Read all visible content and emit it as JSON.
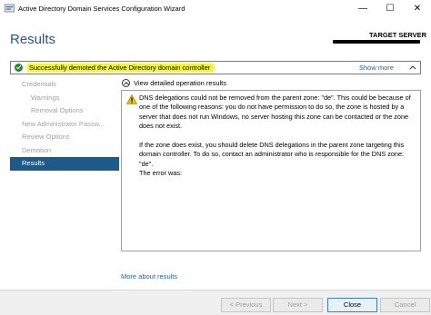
{
  "window": {
    "title": "Active Directory Domain Services Configuration Wizard",
    "min_glyph": "—",
    "max_glyph": "☐",
    "close_glyph": "✕"
  },
  "header": {
    "page_title": "Results",
    "target_label": "TARGET SERVER"
  },
  "status": {
    "message": "Successfully demoted the Active Directory domain controller",
    "show_more": "Show more",
    "highlight_color": "#f3f52e",
    "success_color": "#1e8c2f"
  },
  "nav": {
    "items": [
      {
        "label": "Credentials",
        "sub": false,
        "active": false
      },
      {
        "label": "Warnings",
        "sub": true,
        "active": false
      },
      {
        "label": "Removal Options",
        "sub": true,
        "active": false
      },
      {
        "label": "New Administrator Passw...",
        "sub": false,
        "active": false
      },
      {
        "label": "Review Options",
        "sub": false,
        "active": false
      },
      {
        "label": "Demotion",
        "sub": false,
        "active": false
      },
      {
        "label": "Results",
        "sub": false,
        "active": true
      }
    ]
  },
  "content": {
    "toggle_label": "View detailed operation results",
    "paragraph1": "DNS delegations could not be removed from the parent zone: \"de\". This could be because of one of the following reasons: you do not have permission to do so, the zone is hosted by a server that does not run Windows, no server hosting this zone can be contacted or the zone does not exist.",
    "paragraph2": "If the zone does exist, you should delete DNS delegations in the parent zone targeting this domain controller. To do so, contact an administrator who is responsible for the DNS zone: \"de\".",
    "error_line": "The error was:",
    "more_link": "More about results"
  },
  "buttons": {
    "previous": "< Previous",
    "next": "Next >",
    "close": "Close",
    "cancel": "Cancel"
  },
  "colors": {
    "accent": "#1c5a8c",
    "link": "#1a63b0"
  }
}
